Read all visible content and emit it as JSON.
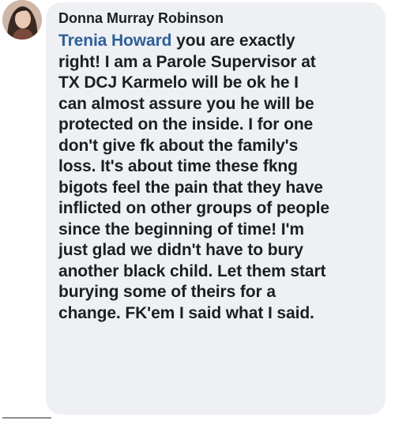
{
  "comment": {
    "author_name": "Donna Murray Robinson",
    "mention": "Trenia Howard",
    "lines": [
      " you are exactly",
      "right! I am a Parole Supervisor at",
      "TX DCJ Karmelo will be ok he I",
      "can almost assure you he will be",
      "protected on the inside. I for one",
      "don't give fk about the family's",
      "loss. It's about time these fkng",
      "bigots feel the pain that they have",
      "inflicted on other groups of people",
      "since the beginning of time! I'm",
      "just glad we didn't have to bury",
      "another black child. Let them start",
      "burying some of theirs for a",
      "change. FK'em I said what I said."
    ]
  },
  "colors": {
    "bubble_background": "#eef0f3",
    "text": "#1c1e21",
    "mention": "#2d5f9a"
  },
  "icons": {
    "avatar": "profile-photo"
  }
}
